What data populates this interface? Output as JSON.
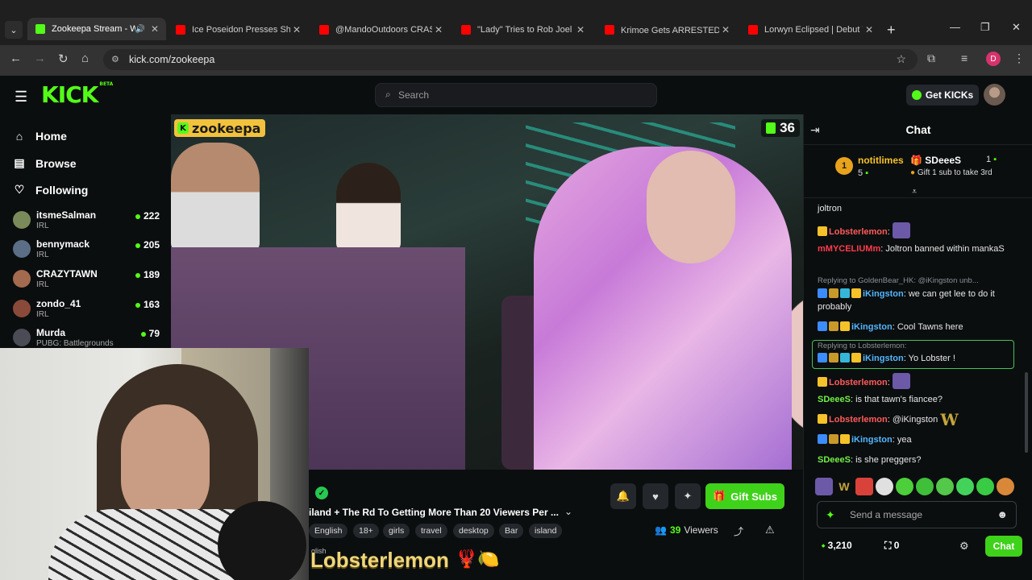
{
  "colors": {
    "kick_green": "#53fc18",
    "button_green": "#3fd21a",
    "youtube_red": "#ff0000",
    "mod_red": "#ff3b4b",
    "name_green": "#72f046",
    "name_blue": "#53b7ff",
    "name_yellow": "#f5c22a"
  },
  "browser": {
    "tabs": [
      {
        "title": "Zookeepa Stream - Wa",
        "favicon": "kick-favicon",
        "active": true,
        "audio": true
      },
      {
        "title": "Ice Poseidon Presses Shoo",
        "favicon": "youtube-favicon"
      },
      {
        "title": "@MandoOutdoors CRASH",
        "favicon": "youtube-favicon"
      },
      {
        "title": "\"Lady\" Tries to Rob Joel | k",
        "favicon": "youtube-favicon"
      },
      {
        "title": "Krimoe Gets ARRESTED! ✈",
        "favicon": "youtube-favicon"
      },
      {
        "title": "Lorwyn Eclipsed | Debut V",
        "favicon": "youtube-favicon"
      }
    ],
    "url": "kick.com/zookeepa",
    "profile_initial": "D"
  },
  "header": {
    "logo": "KICK",
    "logo_tag": "BETA",
    "search_placeholder": "Search",
    "get_kicks": "Get KICKs"
  },
  "sidebar": {
    "nav": [
      {
        "label": "Home",
        "icon": "home-icon"
      },
      {
        "label": "Browse",
        "icon": "browse-icon"
      },
      {
        "label": "Following",
        "icon": "heart-icon"
      }
    ],
    "channels": [
      {
        "name": "itsmeSalman",
        "category": "IRL",
        "viewers": "222",
        "avatar_color": "#7b8a5a"
      },
      {
        "name": "bennymack",
        "category": "IRL",
        "viewers": "205",
        "avatar_color": "#5b6e86"
      },
      {
        "name": "CRAZYTAWN",
        "category": "IRL",
        "viewers": "189",
        "avatar_color": "#a36a4f"
      },
      {
        "name": "zondo_41",
        "category": "IRL",
        "viewers": "163",
        "avatar_color": "#8a4a3a"
      },
      {
        "name": "Murda",
        "category": "PUBG: Battlegrounds",
        "viewers": "79",
        "avatar_color": "#4b4b55"
      }
    ]
  },
  "stream": {
    "channel": "zookeepa",
    "viewer_count": "36",
    "title": "iland + The Rd To Getting More Than 20 Viewers Per ...",
    "tags": [
      "English",
      "18+",
      "girls",
      "travel",
      "desktop",
      "Bar",
      "island"
    ],
    "tag_overflow": "glish",
    "viewers": "39",
    "viewers_label": "Viewers",
    "gift_subs": "Gift Subs",
    "overlay_name": "Lobsterlemon",
    "overlay_emojis": "🦞🍋"
  },
  "chat": {
    "title": "Chat",
    "pinned": {
      "rank": "1",
      "user1": "notitlimes",
      "count1": "5",
      "user2": "SDeeeS",
      "count2": "1",
      "gift_text": "Gift 1 sub to take 3rd"
    },
    "messages": [
      {
        "user": "",
        "text": "joltron"
      },
      {
        "user": "Lobsterlemon",
        "text": ""
      },
      {
        "user": "mMYCELIUMm",
        "text": "Joltron banned within mankaS"
      },
      {
        "reply": "Replying to GoldenBear_HK: @iKingston unb...",
        "user": "iKingston",
        "text": "we can get lee to do it probably"
      },
      {
        "user": "iKingston",
        "text": "Cool Tawns here"
      },
      {
        "reply": "Replying to Lobsterlemon:",
        "user": "iKingston",
        "text": "Yo Lobster !"
      },
      {
        "user": "Lobsterlemon",
        "text": ""
      },
      {
        "user": "SDeeeS",
        "text": "is that tawn's fiancee?"
      },
      {
        "user": "Lobsterlemon",
        "text": "@iKingston"
      },
      {
        "user": "iKingston",
        "text": "yea"
      },
      {
        "user": "SDeeeS",
        "text": "is she preggers?"
      }
    ],
    "input_placeholder": "Send a message",
    "points": "3,210",
    "points2": "0",
    "send": "Chat"
  }
}
